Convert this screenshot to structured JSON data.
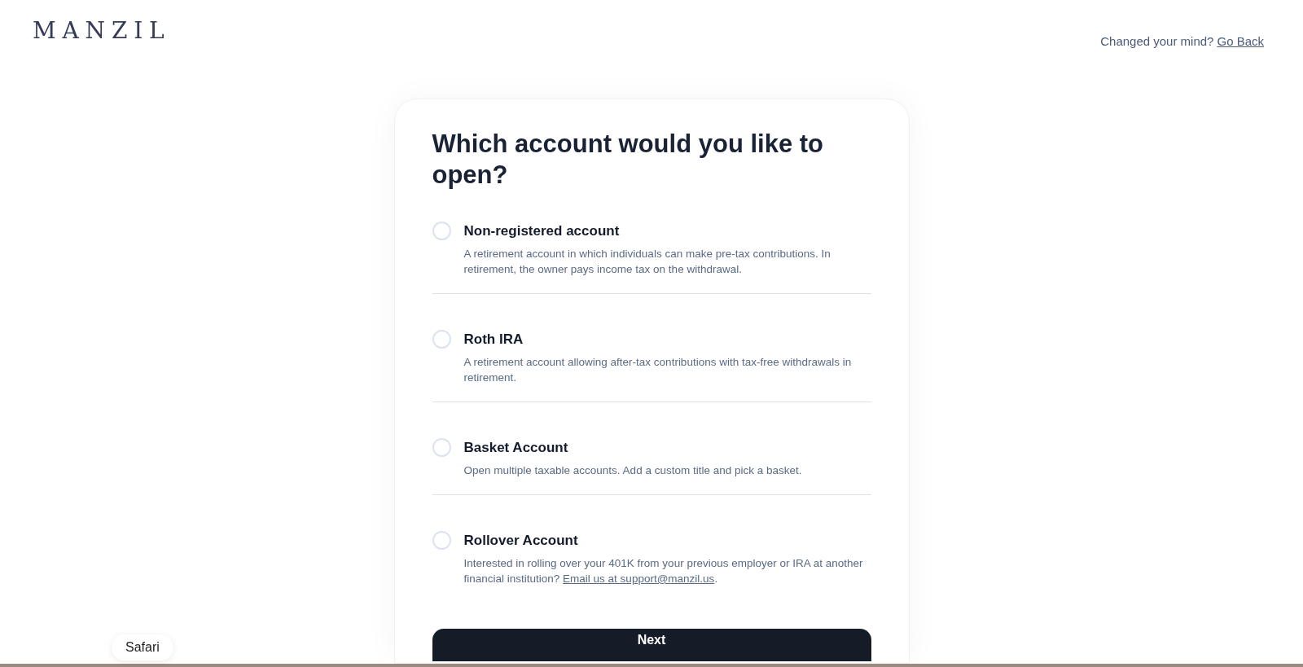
{
  "header": {
    "logo": "MANZIL",
    "prompt": "Changed your mind?",
    "link": "Go Back"
  },
  "card": {
    "title": "Which account would you like to open?",
    "options": [
      {
        "title": "Non-registered account",
        "description": "A retirement account in which individuals can make pre-tax contributions. In retirement, the owner pays income tax on the withdrawal.",
        "selected": false
      },
      {
        "title": "Roth IRA",
        "description": "A retirement account allowing after-tax contributions with tax-free withdrawals in retirement.",
        "selected": false
      },
      {
        "title": "Basket Account",
        "description": "Open multiple taxable accounts. Add a custom title and pick a basket.",
        "selected": false
      },
      {
        "title": "Rollover Account",
        "description": "Interested in rolling over your 401K from your previous employer or IRA at another financial institution?",
        "link": "Email us at support@manzil.us",
        "after": ".",
        "selected": false
      }
    ],
    "button": "Next"
  },
  "tooltip": "Safari"
}
